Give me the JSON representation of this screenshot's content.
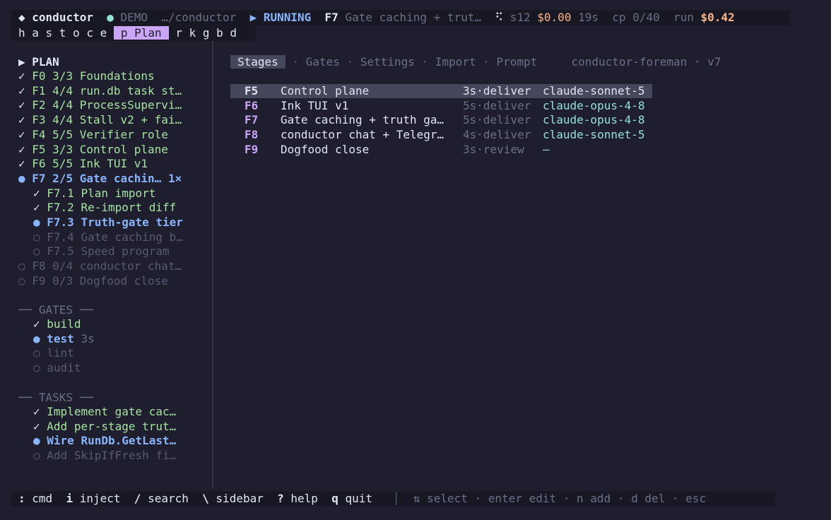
{
  "statusbar": {
    "app_icon": "◆",
    "app_name": "conductor",
    "demo_dot": "●",
    "demo_label": "DEMO",
    "path": "…/conductor",
    "run_icon": "▶",
    "run_state": "RUNNING",
    "current_id": "F7",
    "current_title": "Gate caching + trut…",
    "spinner": "⠫",
    "session": "s12",
    "cost": "$0.00",
    "elapsed": "19s",
    "checkpoint": "cp 0/40",
    "run_label": "run",
    "run_cost": "$0.42"
  },
  "tabbar": {
    "before": "h a s t o c e",
    "active": "p Plan",
    "after": "r k g b d"
  },
  "sidebar": {
    "plan_header": "▶ PLAN",
    "plan_items": [
      {
        "mark": "✓",
        "label": "F0 3/3 Foundations",
        "state": "done"
      },
      {
        "mark": "✓",
        "label": "F1 4/4 run.db task st…",
        "state": "done"
      },
      {
        "mark": "✓",
        "label": "F2 4/4 ProcessSupervi…",
        "state": "done"
      },
      {
        "mark": "✓",
        "label": "F3 4/4 Stall v2 + fai…",
        "state": "done"
      },
      {
        "mark": "✓",
        "label": "F4 5/5 Verifier role",
        "state": "done"
      },
      {
        "mark": "✓",
        "label": "F5 3/3 Control plane",
        "state": "done"
      },
      {
        "mark": "✓",
        "label": "F6 5/5 Ink TUI v1",
        "state": "done"
      },
      {
        "mark": "●",
        "label": "F7 2/5 Gate cachin… 1×",
        "state": "active"
      },
      {
        "mark": "✓",
        "label": "F7.1 Plan import",
        "state": "done",
        "indent": true
      },
      {
        "mark": "✓",
        "label": "F7.2 Re-import diff",
        "state": "done",
        "indent": true
      },
      {
        "mark": "●",
        "label": "F7.3 Truth-gate tier",
        "state": "active",
        "indent": true
      },
      {
        "mark": "○",
        "label": "F7.4 Gate caching b…",
        "state": "pending",
        "indent": true
      },
      {
        "mark": "○",
        "label": "F7.5 Speed program",
        "state": "pending",
        "indent": true
      },
      {
        "mark": "○",
        "label": "F8 0/4 conductor chat…",
        "state": "pending"
      },
      {
        "mark": "○",
        "label": "F9 0/3 Dogfood close",
        "state": "pending"
      }
    ],
    "gates_header": "── GATES ──",
    "gates": [
      {
        "mark": "✓",
        "label": "build",
        "extra": "",
        "state": "done"
      },
      {
        "mark": "●",
        "label": "test",
        "extra": "3s",
        "state": "active"
      },
      {
        "mark": "○",
        "label": "lint",
        "extra": "",
        "state": "pending"
      },
      {
        "mark": "○",
        "label": "audit",
        "extra": "",
        "state": "pending"
      }
    ],
    "tasks_header": "── TASKS ──",
    "tasks": [
      {
        "mark": "✓",
        "label": "Implement gate cac…",
        "state": "done"
      },
      {
        "mark": "✓",
        "label": "Add per-stage trut…",
        "state": "done"
      },
      {
        "mark": "●",
        "label": "Wire RunDb.GetLast…",
        "state": "active"
      },
      {
        "mark": "○",
        "label": "Add SkipIfFresh fi…",
        "state": "pending"
      }
    ]
  },
  "main": {
    "tabs": {
      "active": "Stages",
      "others": [
        "Gates",
        "Settings",
        "Import",
        "Prompt"
      ],
      "sep": "·",
      "profile": "conductor-foreman",
      "version": "v7"
    },
    "stages": [
      {
        "id": "F5",
        "title": "Control plane",
        "dur": "3s",
        "phase": "deliver",
        "model": "claude-sonnet-5",
        "selected": true
      },
      {
        "id": "F6",
        "title": "Ink TUI v1",
        "dur": "5s",
        "phase": "deliver",
        "model": "claude-opus-4-8"
      },
      {
        "id": "F7",
        "title": "Gate caching + truth ga…",
        "dur": "5s",
        "phase": "deliver",
        "model": "claude-opus-4-8"
      },
      {
        "id": "F8",
        "title": "conductor chat + Telegr…",
        "dur": "4s",
        "phase": "deliver",
        "model": "claude-sonnet-5"
      },
      {
        "id": "F9",
        "title": "Dogfood close",
        "dur": "3s",
        "phase": "review",
        "model": "—"
      }
    ]
  },
  "footer": {
    "keys": [
      {
        "key": ":",
        "label": "cmd"
      },
      {
        "key": "i",
        "label": "inject"
      },
      {
        "key": "/",
        "label": "search"
      },
      {
        "key": "\\",
        "label": "sidebar"
      },
      {
        "key": "?",
        "label": "help"
      },
      {
        "key": "q",
        "label": "quit"
      }
    ],
    "divider": "│",
    "hints": "⇅ select · enter edit · n add · d del · esc"
  }
}
